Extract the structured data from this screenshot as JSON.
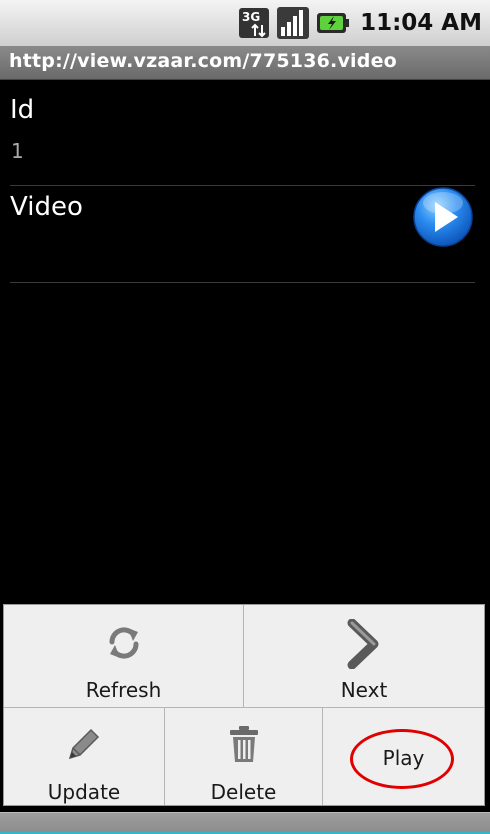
{
  "status_bar": {
    "network_type": "3G",
    "time": "11:04 AM"
  },
  "title_bar": {
    "url": "http://view.vzaar.com/775136.video"
  },
  "fields": [
    {
      "label": "Id",
      "value": "1"
    },
    {
      "label": "Video",
      "action_icon": "play-icon"
    }
  ],
  "options_menu": {
    "items": [
      {
        "label": "Refresh",
        "icon": "refresh-icon"
      },
      {
        "label": "Next",
        "icon": "chevron-right-icon"
      },
      {
        "label": "Update",
        "icon": "pencil-icon"
      },
      {
        "label": "Delete",
        "icon": "trash-icon"
      },
      {
        "label": "Play",
        "icon": ""
      }
    ]
  },
  "colors": {
    "background": "#000000",
    "menu_background": "#efefef",
    "title_bar": "#7a7a7a",
    "play_icon": "#1e7ee6",
    "annotation_circle": "#e00000"
  }
}
